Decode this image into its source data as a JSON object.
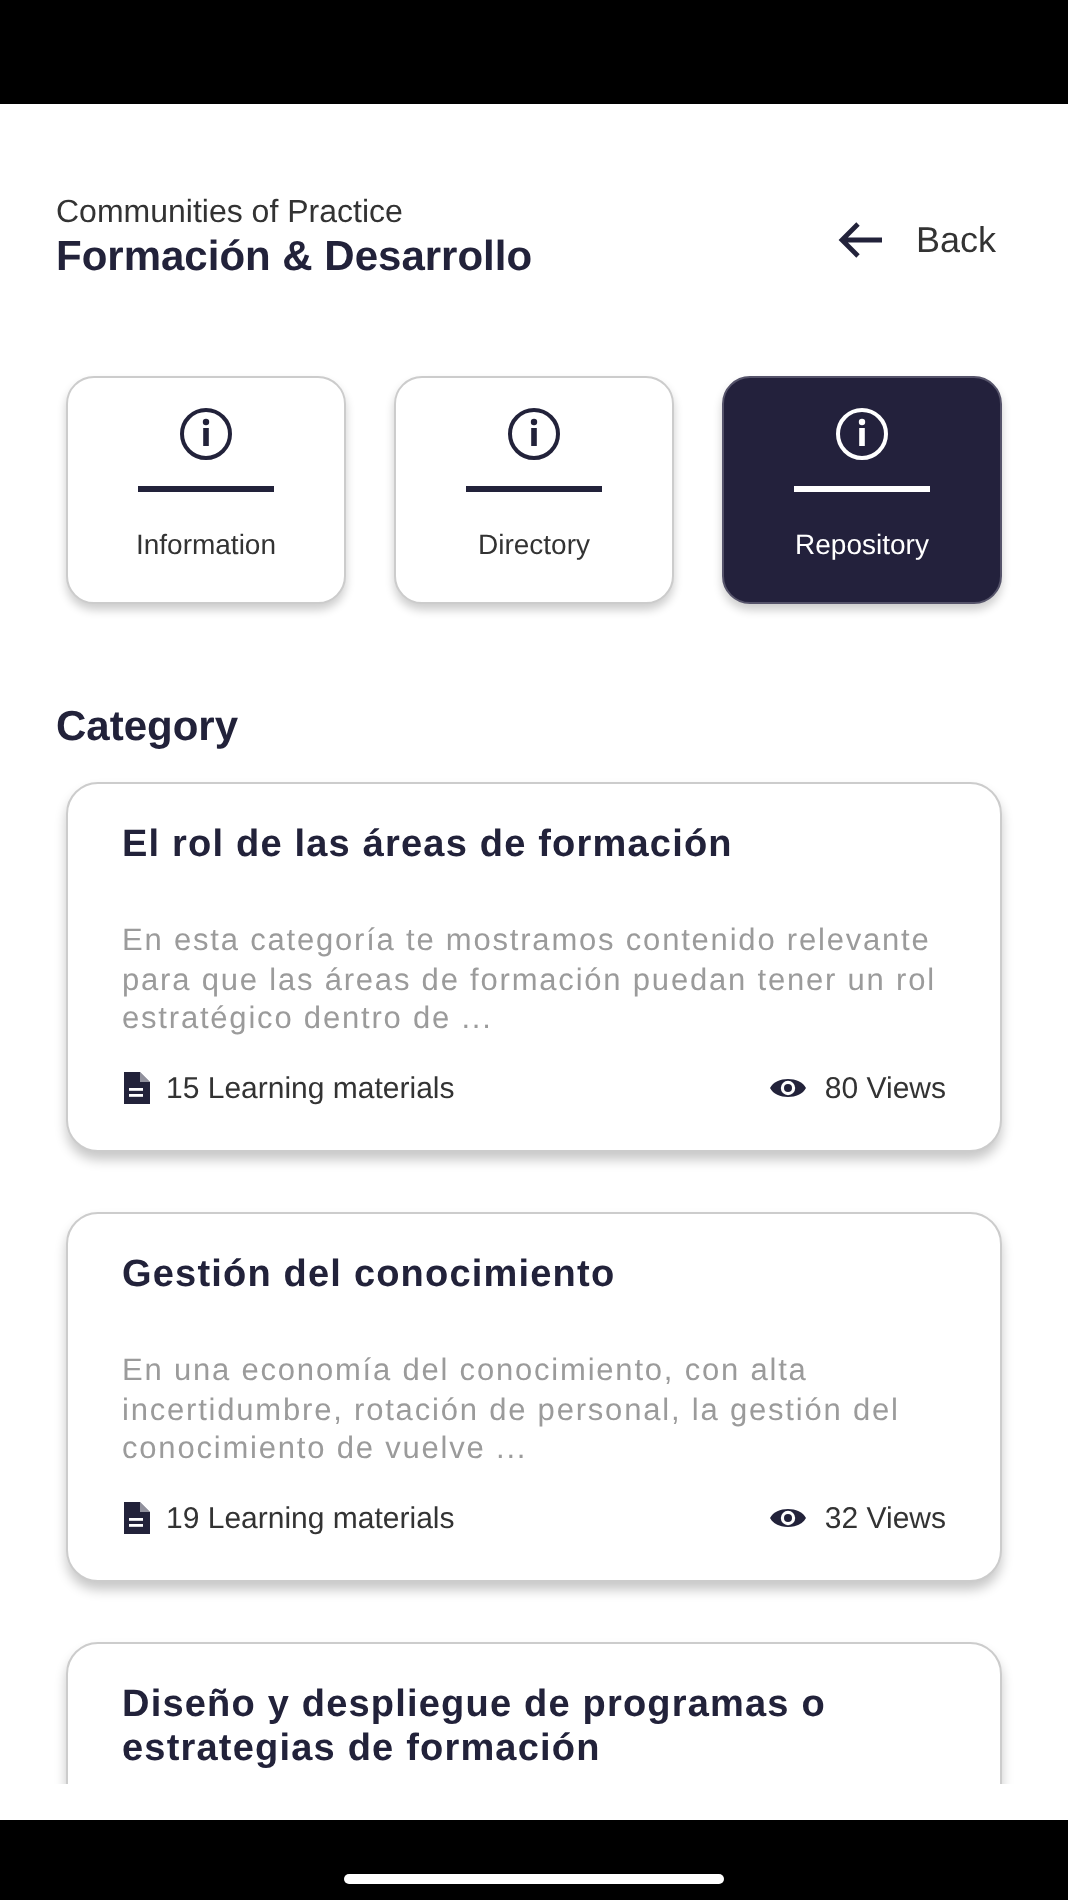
{
  "header": {
    "subtitle": "Communities of Practice",
    "title": "Formación & Desarrollo",
    "back": "Back"
  },
  "tabs": [
    {
      "label": "Information",
      "selected": false
    },
    {
      "label": "Directory",
      "selected": false
    },
    {
      "label": "Repository",
      "selected": true
    }
  ],
  "section": {
    "title": "Category"
  },
  "categories": [
    {
      "title": "El rol de las áreas de formación",
      "description": "En esta categoría te mostramos contenido relevante para que las áreas de formación puedan tener un rol estratégico dentro de ...",
      "materials": "15 Learning materials",
      "views": "80 Views"
    },
    {
      "title": "Gestión del conocimiento",
      "description": "En una economía del conocimiento, con alta incertidumbre, rotación de personal, la gestión del conocimiento de vuelve ...",
      "materials": "19 Learning materials",
      "views": "32 Views"
    },
    {
      "title": "Diseño y despliegue de programas o estrategias de formación"
    }
  ]
}
